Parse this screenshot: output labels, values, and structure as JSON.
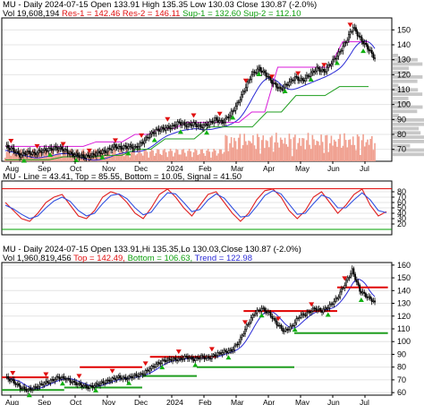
{
  "header": {
    "symbol_line": "MU - Daily 2024-07-15 Open 133.91  High 135.35  Low 130.03  Close 130.87 (-2.0%)",
    "vol_prefix": "Vol 19,608,194",
    "res1": "Res-1 = 142.46",
    "res2": "Res-2 = 146.11",
    "sup1": "Sup-1 = 132.60",
    "sup2": "Sup-2 = 112.10",
    "mu_line_label": "MU - Line = 43.41,  Top = 85.55,  Bottom = 10.05,  Signal = 41.50",
    "lower_line1": "MU - Daily 2024-07-15 Open 133.91,Hi 135.35,Lo 130.03,Close 130.87 (-2.0%)",
    "lower_line2_a": "Vol 1,960,819,456",
    "lower_line2_b": "Top = 142.49,",
    "lower_line2_c": "Bottom = 106.63,",
    "lower_line2_d": "Trend = 122.98"
  },
  "colors": {
    "candle": "#000000",
    "ma_blue": "#2b2bd6",
    "res_magenta": "#d81bd8",
    "sup_green": "#1f9e1f",
    "arrow_red": "#e01010",
    "arrow_green": "#10b010",
    "volume": "#f0a090",
    "profile": "#c8c8c8",
    "osc_red": "#e02020",
    "osc_blue": "#3050e0",
    "top_red": "#e00000",
    "bottom_green": "#00a000"
  },
  "chart_data": [
    {
      "type": "candlestick",
      "panel": "top",
      "x_ticks": [
        "Aug",
        "Sep",
        "Oct",
        "Nov",
        "Dec",
        "2024",
        "Feb",
        "Mar",
        "Apr",
        "May",
        "Jun",
        "Jul"
      ],
      "ylim": [
        62,
        158
      ],
      "y_ticks": [
        70,
        80,
        90,
        100,
        110,
        120,
        130,
        140,
        150
      ],
      "close_series": [
        72,
        70,
        66,
        68,
        67,
        69,
        70,
        71,
        70,
        67,
        66,
        65,
        66,
        68,
        69,
        72,
        71,
        72,
        71,
        75,
        80,
        83,
        84,
        85,
        88,
        86,
        87,
        85,
        87,
        90,
        88,
        93,
        100,
        110,
        120,
        124,
        120,
        114,
        110,
        114,
        118,
        116,
        120,
        124,
        122,
        128,
        134,
        142,
        152,
        144,
        138,
        131
      ],
      "resistance_line": [
        72,
        72,
        72,
        72,
        72,
        72,
        72,
        75,
        75,
        75,
        80,
        80,
        84,
        84,
        88,
        88,
        88,
        88,
        88,
        95,
        95,
        125,
        125,
        125,
        125,
        125,
        142,
        142,
        142
      ],
      "support_line": [
        63,
        63,
        63,
        63,
        65,
        65,
        65,
        66,
        66,
        70,
        70,
        77,
        77,
        77,
        85,
        85,
        85,
        85,
        95,
        95,
        106,
        106,
        106,
        112,
        112,
        112
      ],
      "volume_bars": true
    },
    {
      "type": "line",
      "panel": "oscillator",
      "ylim": [
        0,
        100
      ],
      "y_ticks": [
        20,
        30,
        40,
        50,
        60,
        70,
        80
      ],
      "series": [
        {
          "values": [
            60,
            45,
            30,
            25,
            40,
            60,
            70,
            75,
            55,
            35,
            30,
            45,
            70,
            80,
            75,
            60,
            40,
            30,
            50,
            75,
            85,
            70,
            50,
            35,
            55,
            75,
            80,
            60,
            40,
            25,
            40,
            65,
            82,
            85,
            70,
            45,
            30,
            45,
            70,
            80,
            60,
            40,
            55,
            75,
            85,
            55,
            35,
            43
          ]
        },
        {
          "values": [
            55,
            48,
            38,
            30,
            35,
            50,
            63,
            70,
            62,
            45,
            35,
            40,
            58,
            73,
            76,
            67,
            50,
            37,
            42,
            62,
            78,
            76,
            60,
            43,
            47,
            65,
            76,
            68,
            50,
            33,
            35,
            53,
            73,
            82,
            76,
            57,
            38,
            40,
            58,
            74,
            68,
            50,
            50,
            65,
            78,
            65,
            45,
            41
          ]
        }
      ],
      "top_level": 85.55,
      "bottom_level": 10.05
    },
    {
      "type": "candlestick",
      "panel": "bottom",
      "x_ticks": [
        "Aug",
        "Sep",
        "Oct",
        "Nov",
        "Dec",
        "2024",
        "Feb",
        "Mar",
        "Apr",
        "May",
        "Jun",
        "Jul"
      ],
      "ylim": [
        58,
        162
      ],
      "y_ticks": [
        60,
        70,
        80,
        90,
        100,
        110,
        120,
        130,
        140,
        150,
        160
      ],
      "close_series": [
        72,
        69,
        64,
        62,
        64,
        67,
        69,
        72,
        71,
        68,
        66,
        64,
        66,
        68,
        70,
        72,
        71,
        73,
        74,
        78,
        82,
        85,
        86,
        86,
        88,
        86,
        88,
        87,
        90,
        92,
        93,
        100,
        112,
        122,
        126,
        122,
        114,
        108,
        112,
        120,
        122,
        126,
        124,
        128,
        134,
        145,
        156,
        140,
        135,
        131
      ],
      "top_line": 142.49,
      "bottom_line": 106.63,
      "trend": 122.98
    }
  ]
}
